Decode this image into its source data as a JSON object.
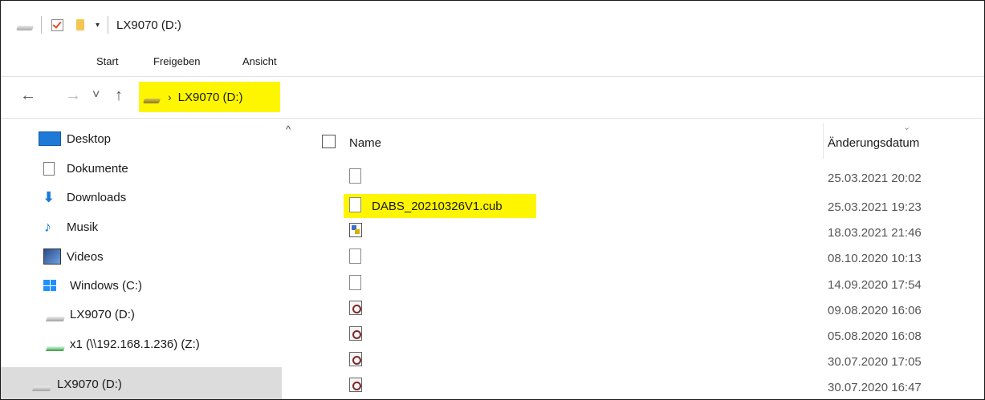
{
  "window": {
    "title": "LX9070 (D:)"
  },
  "quick_access": {
    "drop_glyph": "▾"
  },
  "ribbon": {
    "tabs": [
      "Start",
      "Freigeben",
      "Ansicht"
    ]
  },
  "nav": {
    "back_glyph": "←",
    "forward_glyph": "→",
    "recent_glyph": "˅",
    "up_glyph": "↑",
    "crumb_chevron": "›",
    "breadcrumb": "LX9070 (D:)",
    "highlight_color": "#fef600"
  },
  "sidebar": {
    "scroll_up_glyph": "^",
    "items": [
      {
        "label": "Desktop",
        "icon": "desktop-icon"
      },
      {
        "label": "Dokumente",
        "icon": "documents-icon"
      },
      {
        "label": "Downloads",
        "icon": "downloads-icon",
        "glyph": "⬇"
      },
      {
        "label": "Musik",
        "icon": "music-icon",
        "glyph": "♪"
      },
      {
        "label": "Videos",
        "icon": "videos-icon"
      },
      {
        "label": "Windows (C:)",
        "icon": "windows-drive-icon"
      },
      {
        "label": "LX9070 (D:)",
        "icon": "drive-icon"
      },
      {
        "label": "x1 (\\\\192.168.1.236) (Z:)",
        "icon": "network-drive-icon"
      },
      {
        "label": "LX9070 (D:)",
        "icon": "drive-icon",
        "selected": true
      }
    ]
  },
  "columns": {
    "name": "Name",
    "date": "Änderungsdatum",
    "sort_glyph": "⌄"
  },
  "files": [
    {
      "name": "",
      "date": "25.03.2021 20:02",
      "icon": "blank-file-icon"
    },
    {
      "name": "DABS_20210326V1.cub",
      "date": "25.03.2021 19:23",
      "icon": "cub-file-icon",
      "highlighted": true
    },
    {
      "name": "",
      "date": "18.03.2021 21:46",
      "icon": "program-file-icon"
    },
    {
      "name": "",
      "date": "08.10.2020 10:13",
      "icon": "blank-file-icon"
    },
    {
      "name": "",
      "date": "14.09.2020 17:54",
      "icon": "blank-file-icon"
    },
    {
      "name": "",
      "date": "09.08.2020 16:06",
      "icon": "settings-file-icon"
    },
    {
      "name": "",
      "date": "05.08.2020 16:08",
      "icon": "settings-file-icon"
    },
    {
      "name": "",
      "date": "30.07.2020 17:05",
      "icon": "settings-file-icon"
    },
    {
      "name": "",
      "date": "30.07.2020 16:47",
      "icon": "settings-file-icon"
    }
  ]
}
